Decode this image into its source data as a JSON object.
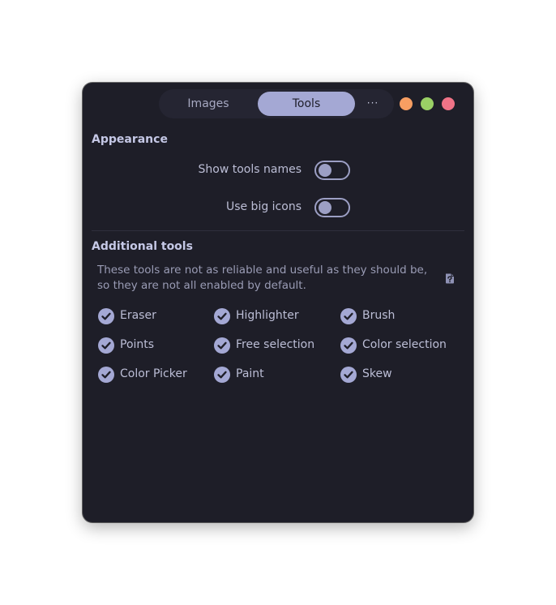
{
  "colors": {
    "window_bg": "#1e1e28",
    "accent": "#a4a8d4",
    "minimize": "#f79e62",
    "maximize": "#9ad065",
    "close": "#f07387"
  },
  "header": {
    "tabs": [
      {
        "label": "Images",
        "active": false
      },
      {
        "label": "Tools",
        "active": true
      }
    ],
    "more_label": "···"
  },
  "appearance": {
    "title": "Appearance",
    "show_tools_names": {
      "label": "Show tools names",
      "enabled": false
    },
    "use_big_icons": {
      "label": "Use big icons",
      "enabled": false
    }
  },
  "additional": {
    "title": "Additional tools",
    "description": "These tools are not as reliable and useful as they should be, so they are not all enabled by default.",
    "help_icon": "help-document-icon",
    "tools": [
      {
        "label": "Eraser",
        "checked": true
      },
      {
        "label": "Highlighter",
        "checked": true
      },
      {
        "label": "Brush",
        "checked": true
      },
      {
        "label": "Points",
        "checked": true
      },
      {
        "label": "Free selection",
        "checked": true
      },
      {
        "label": "Color selection",
        "checked": true
      },
      {
        "label": "Color Picker",
        "checked": true
      },
      {
        "label": "Paint",
        "checked": true
      },
      {
        "label": "Skew",
        "checked": true
      }
    ]
  }
}
